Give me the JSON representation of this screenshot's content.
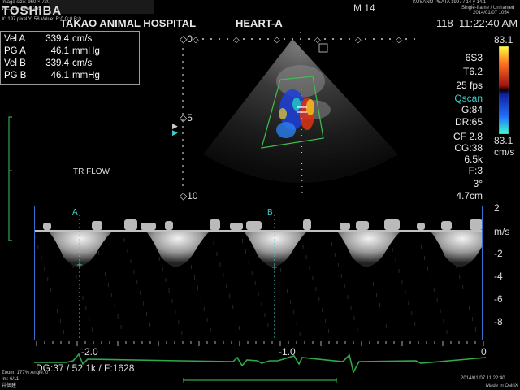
{
  "header": {
    "hospital": "TAKAO ANIMAL HOSPITAL",
    "exam": "HEART-A",
    "brand": "TOSHIBA",
    "mode_code": "M 14",
    "frame_number": "118",
    "time": "11:22:40 AM",
    "small_left_1": "Image size: 960 × 720",
    "small_left_2": "WL: 127 WW: 255",
    "small_left_3": "X: 197 pixel Y: 58 Value: R:0 G:0 B:0",
    "patient_line": "KUSANO PEATA   1997 / 14 y   14.1",
    "right_small_2": "Single-frame / Unframed",
    "date_small": "2014/01/07 1054"
  },
  "measurements": [
    {
      "label": "Vel  A",
      "value": "339.4",
      "unit": "cm/s"
    },
    {
      "label": "PG  A",
      "value": "46.1",
      "unit": "mmHg"
    },
    {
      "label": "Vel  B",
      "value": "339.4",
      "unit": "cm/s"
    },
    {
      "label": "PG  B",
      "value": "46.1",
      "unit": "mmHg"
    }
  ],
  "params": {
    "probe": "6S3",
    "tissue": "T6.2",
    "fps": "25 fps",
    "qscan": "Qscan",
    "gain": "G:84",
    "dr": "DR:65",
    "cf": "CF 2.8",
    "cg": "CG:38",
    "prf": "6.5k",
    "filter": "F:3",
    "angle": "3°",
    "depth": "4.7cm"
  },
  "color_scale": {
    "top": "83.1",
    "bottom": "83.1",
    "unit": "cm/s"
  },
  "image_labels": {
    "depth_0": "0",
    "depth_5": "5",
    "depth_10": "10",
    "tr_flow": "TR FLOW",
    "marker_a": "A",
    "marker_b": "B"
  },
  "doppler": {
    "y_ticks": [
      "2",
      "-2",
      "-4",
      "-6",
      "-8"
    ],
    "y_unit": "m/s",
    "x_ticks": [
      "-2.0",
      "-1.0",
      "0"
    ],
    "footer_params": "DG:37  / 52.1k  / F:1628"
  },
  "footer": {
    "zoom": "Zoom: 177%  Angle: 0",
    "frame": "Im: 6/11",
    "id": "井伝建",
    "date": "2014/01/07  11:22:40",
    "origin": "Made In OsiriX"
  },
  "colors": {
    "frame_blue": "#3a6ec8",
    "ecg_green": "#2fa84a",
    "roi_green": "#3fbf4f",
    "cyan_marker": "#3fd0d0"
  }
}
